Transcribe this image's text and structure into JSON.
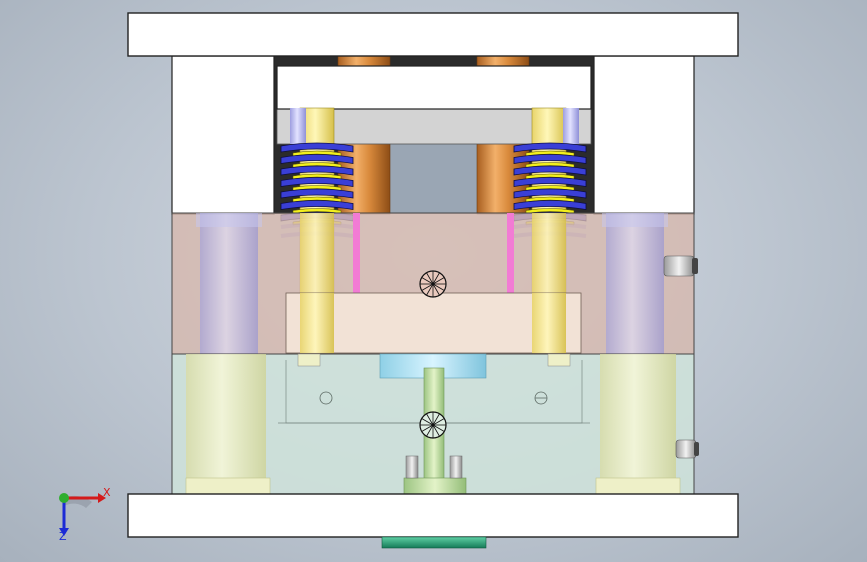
{
  "view": {
    "background_color": "#bfc8d2",
    "triad_labels": {
      "x": "X",
      "z": "Z"
    }
  },
  "colors": {
    "plate_white": "#ffffff",
    "plate_edge": "#222222",
    "a_plate": "#d7b9ad",
    "b_plate": "#cfe3da",
    "ejector_plate": "#f1dfd2",
    "spring_blue": "#3a3fd6",
    "spring_yellow": "#f2ef1e",
    "return_pin_yellow": "#f6ea8c",
    "guide_pin_lavender": "#bfc0f0",
    "copper_pin": "#d98a3c",
    "pink_pin": "#f07ad0",
    "sprue_green": "#bfe0a0",
    "locating_ring_teal": "#2aa87c",
    "spacer_teal": "#9fd9e8"
  },
  "components": [
    "top-clamp-plate",
    "bottom-clamp-plate",
    "ejector-retainer-plate",
    "stripper-plate",
    "a-plate",
    "b-plate",
    "ejector-plate",
    "return-spring-left",
    "return-spring-right",
    "return-pin-left",
    "return-pin-right",
    "guide-pin-left",
    "guide-pin-right",
    "support-pillar-left",
    "support-pillar-right",
    "sprue-bushing",
    "locating-ring"
  ]
}
